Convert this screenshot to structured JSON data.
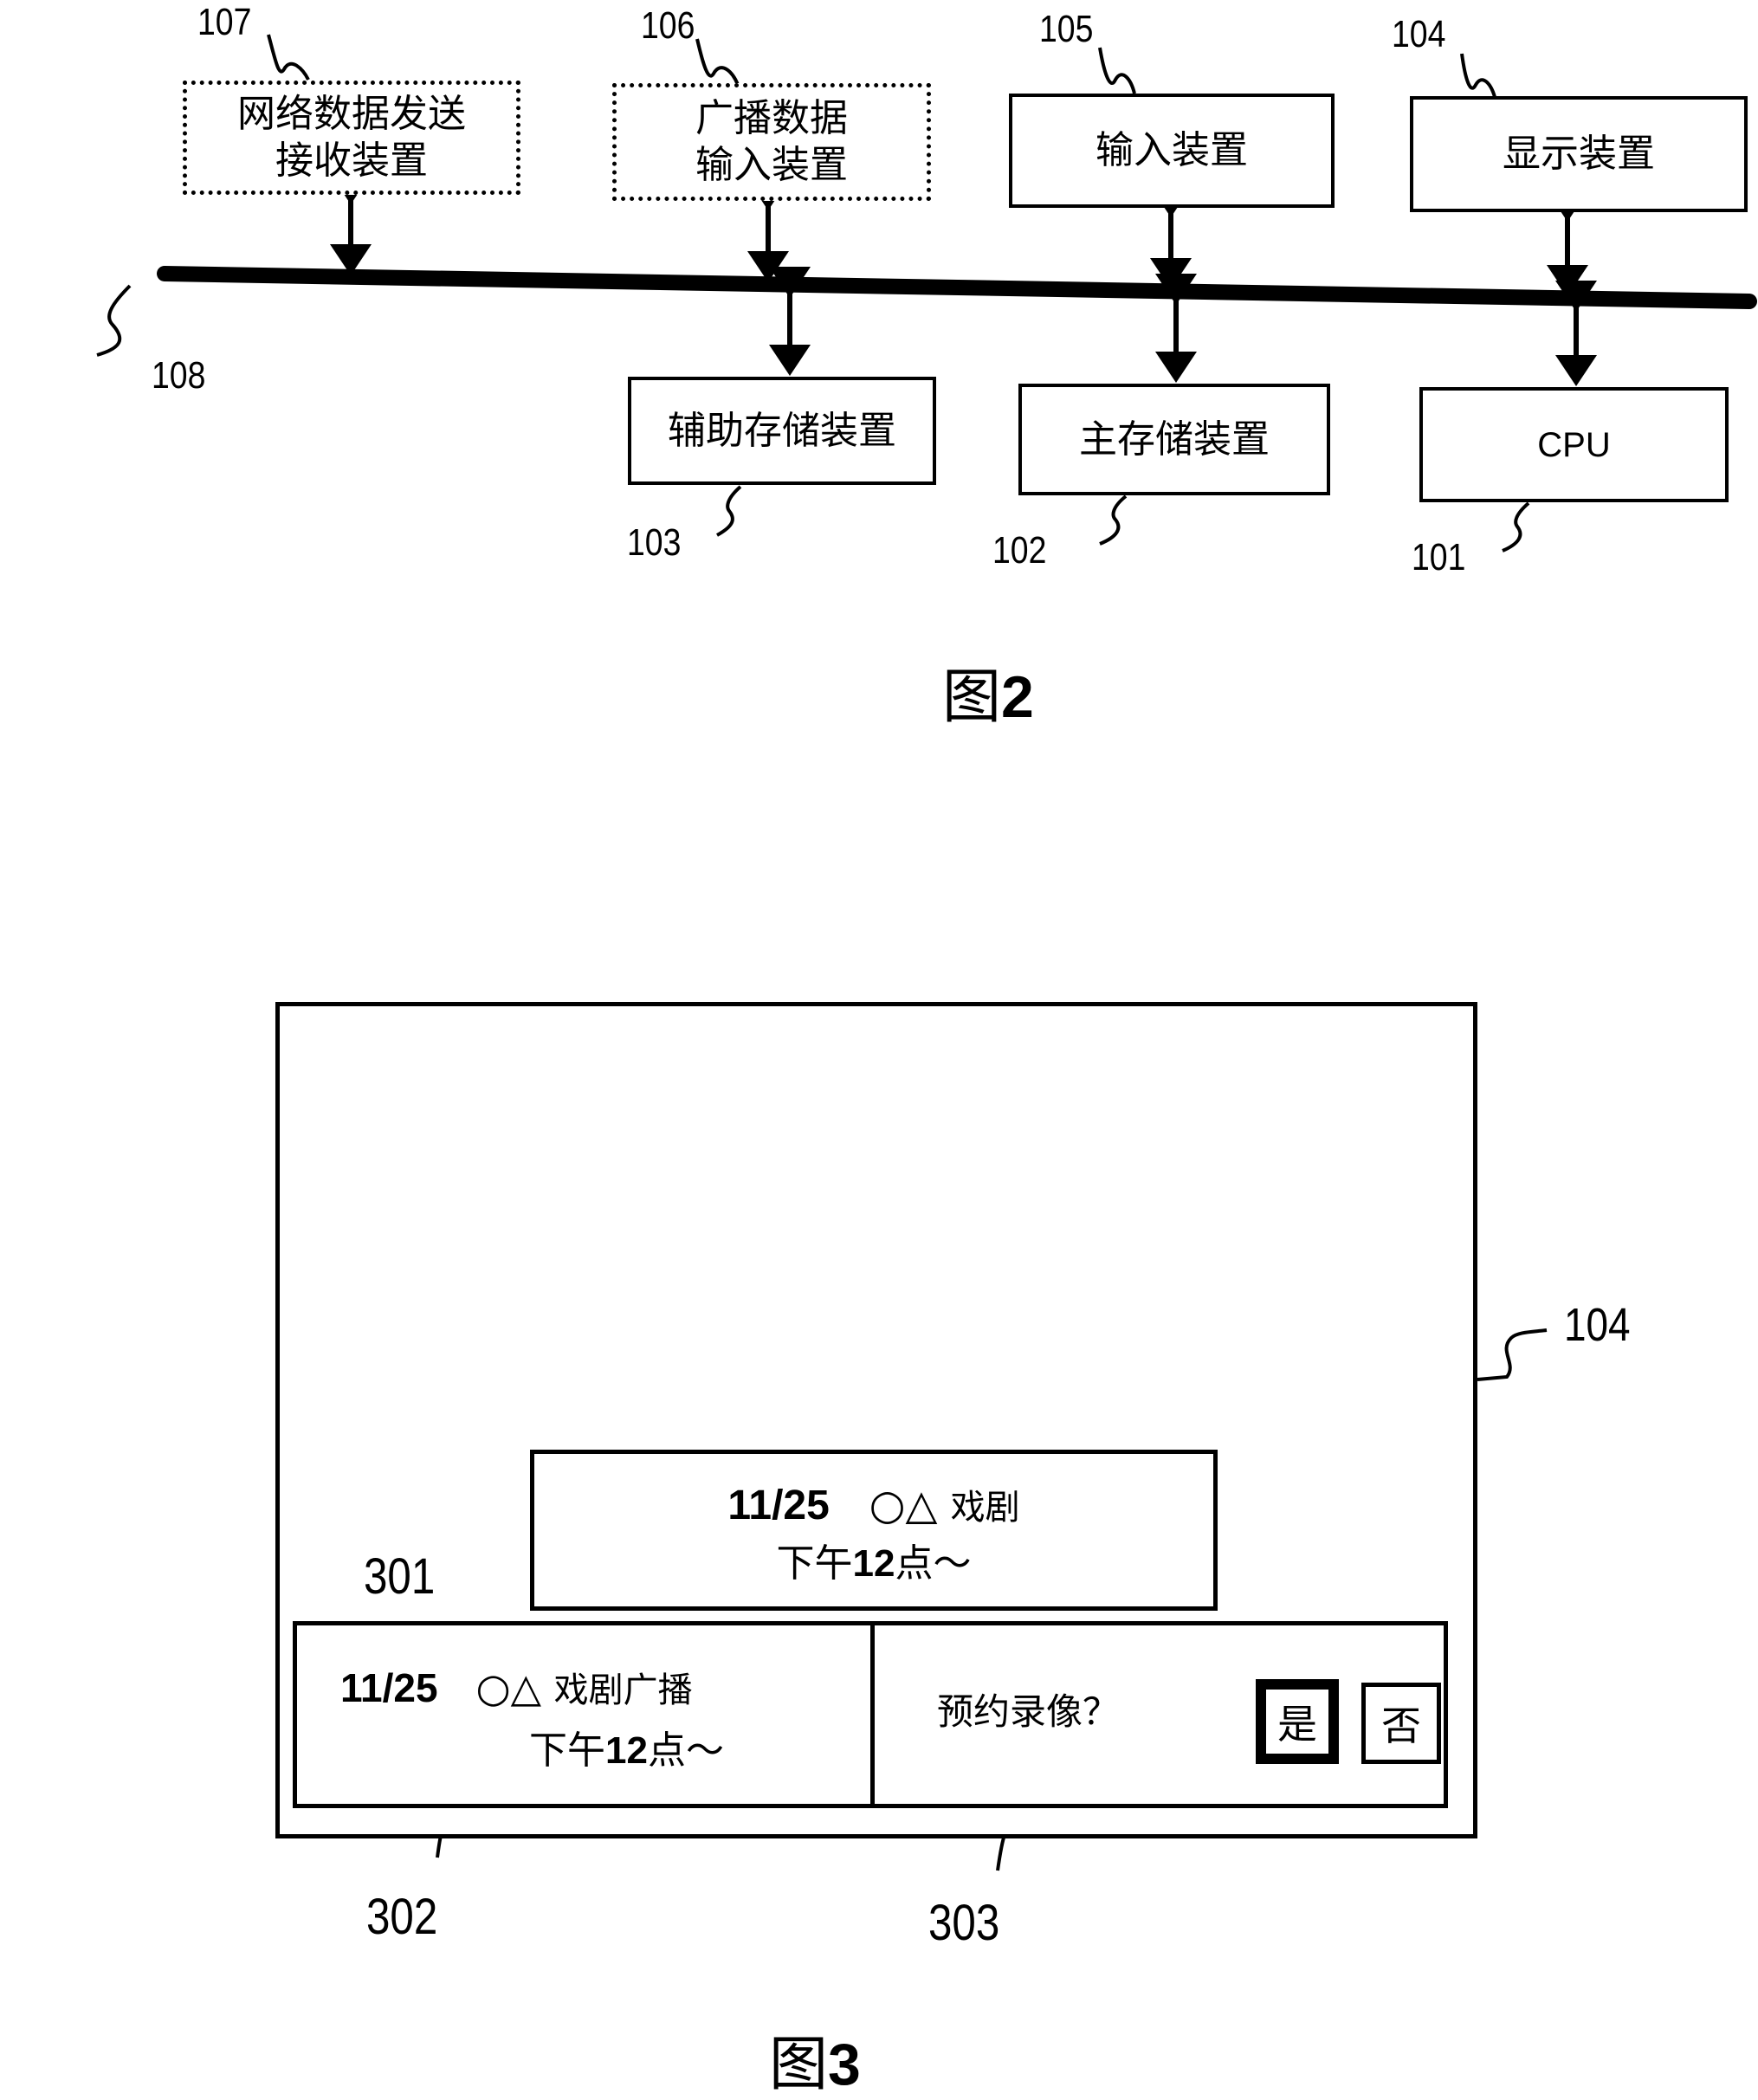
{
  "figure2": {
    "caption_prefix": "图",
    "caption_number": "2",
    "bus": {
      "ref": "108"
    },
    "blocks": [
      {
        "id": "network",
        "ref": "107",
        "lines": [
          "网络数据发送",
          "接收装置"
        ],
        "optional": true
      },
      {
        "id": "broadcast",
        "ref": "106",
        "lines": [
          "广播数据",
          "输入装置"
        ],
        "optional": true
      },
      {
        "id": "input",
        "ref": "105",
        "lines": [
          "输入装置"
        ],
        "optional": false
      },
      {
        "id": "display",
        "ref": "104",
        "lines": [
          "显示装置"
        ],
        "optional": false
      },
      {
        "id": "aux-storage",
        "ref": "103",
        "lines": [
          "辅助存储装置"
        ],
        "optional": false
      },
      {
        "id": "main-storage",
        "ref": "102",
        "lines": [
          "主存储装置"
        ],
        "optional": false
      },
      {
        "id": "cpu",
        "ref": "101",
        "lines": [
          "CPU"
        ],
        "optional": false
      }
    ]
  },
  "figure3": {
    "caption_prefix": "图",
    "caption_number": "3",
    "display_ref": "104",
    "popup_301": {
      "ref": "301",
      "date": "11/25",
      "symbols": "○△",
      "title": "戏剧",
      "time_prefix": "下午",
      "time_number": "12",
      "time_suffix": "点～"
    },
    "panel_302": {
      "ref": "302",
      "date": "11/25",
      "symbols": "○△",
      "title": "戏剧广播",
      "time_prefix": "下午",
      "time_number": "12",
      "time_suffix": "点～"
    },
    "panel_303": {
      "ref": "303",
      "question": "预约录像？",
      "yes_label": "是",
      "no_label": "否",
      "selected": "yes"
    }
  }
}
